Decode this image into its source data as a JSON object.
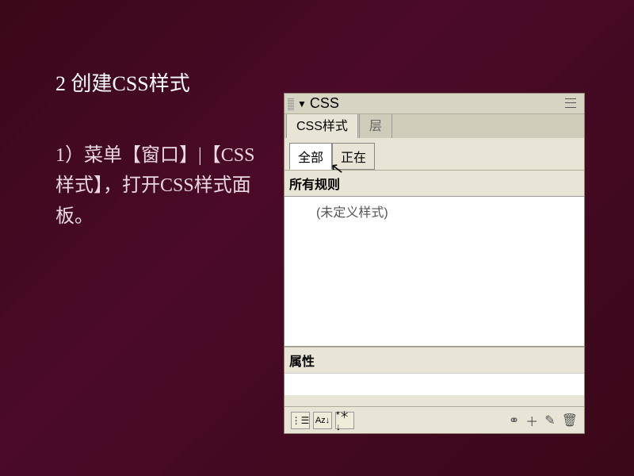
{
  "slide": {
    "heading": "2 创建CSS样式",
    "body": "1）菜单【窗口】|【CSS样式】，打开CSS样式面板。"
  },
  "panel": {
    "title": "CSS",
    "tabs": {
      "css_styles": "CSS样式",
      "layers": "层"
    },
    "sub": {
      "all": "全部",
      "current": "正在"
    },
    "rules_label": "所有规则",
    "no_style": "(未定义样式)",
    "props_label": "属性",
    "footer": {
      "category": "⋮☰",
      "az": "Aᴢ↓",
      "star": "*＊↓",
      "link": "⚭",
      "new": "＋",
      "edit": "✎",
      "delete": "🗑"
    }
  }
}
